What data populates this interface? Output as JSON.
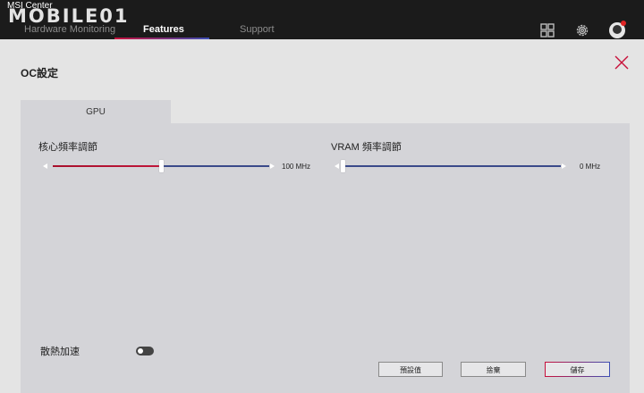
{
  "window": {
    "app_title": "MSI Center",
    "watermark": "MOBILE01"
  },
  "nav": {
    "tabs": [
      {
        "label": "Hardware Monitoring"
      },
      {
        "label": "Features"
      },
      {
        "label": "Support"
      }
    ],
    "active_tab": "Features"
  },
  "page": {
    "title": "OC設定"
  },
  "panel_tab": {
    "label": "GPU"
  },
  "core_slider": {
    "label": "核心頻率調節",
    "value_text": "100 MHz",
    "position": 0.5
  },
  "vram_slider": {
    "label": "VRAM 頻率調節",
    "value_text": "0 MHz",
    "position": 0
  },
  "fan_boost": {
    "label": "散熱加速",
    "enabled": false
  },
  "buttons": {
    "default": "預設值",
    "cancel": "捨棄",
    "save": "儲存"
  },
  "colors": {
    "accent_red": "#c8103b",
    "accent_blue": "#3d4fb5",
    "titlebar": "#1b1b1b"
  },
  "icons": [
    "grid-icon",
    "gear-icon",
    "avatar",
    "close-icon",
    "arrow-left-icon",
    "arrow-right-icon"
  ]
}
